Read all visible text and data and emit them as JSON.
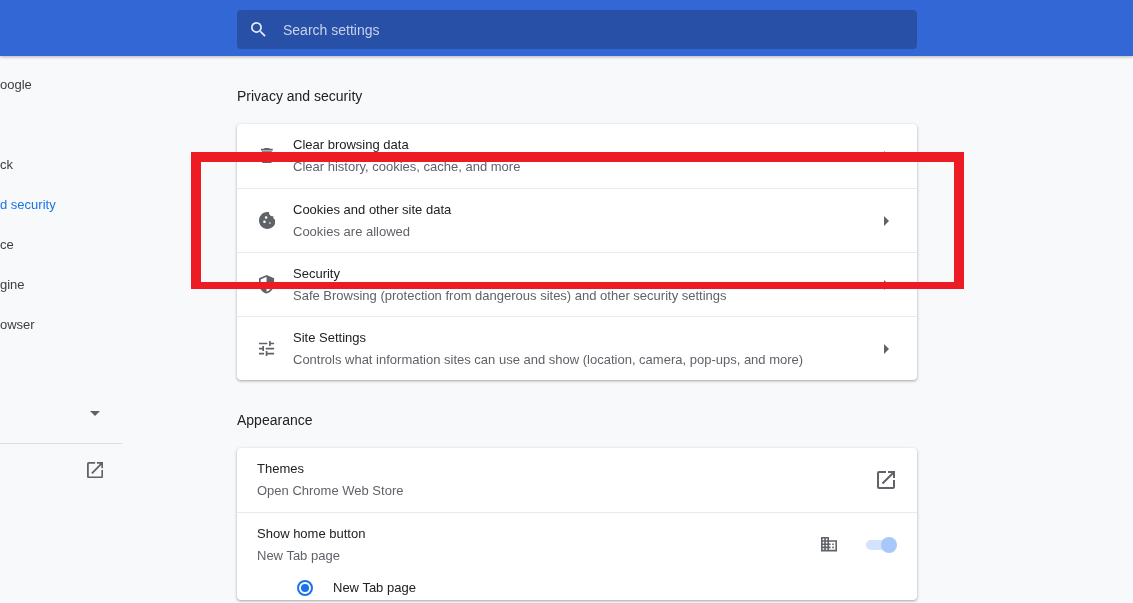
{
  "header": {
    "search": {
      "placeholder": "Search settings"
    }
  },
  "sidebar": {
    "items": [
      {
        "label": "oogle",
        "selected": false
      },
      {
        "label": "ck",
        "selected": false
      },
      {
        "label": "d security",
        "selected": true
      },
      {
        "label": "ce",
        "selected": false
      },
      {
        "label": "gine",
        "selected": false
      },
      {
        "label": "owser",
        "selected": false
      }
    ],
    "advanced": {
      "expanded": false
    }
  },
  "sections": [
    {
      "title": "Privacy and security",
      "rows": [
        {
          "kind": "link",
          "title": "Clear browsing data",
          "subtitle": "Clear history, cookies, cache, and more"
        },
        {
          "kind": "link",
          "title": "Cookies and other site data",
          "subtitle": "Cookies are allowed"
        },
        {
          "kind": "link",
          "title": "Security",
          "subtitle": "Safe Browsing (protection from dangerous sites) and other security settings"
        },
        {
          "kind": "link",
          "title": "Site Settings",
          "subtitle": "Controls what information sites can use and show (location, camera, pop-ups, and more)"
        }
      ]
    },
    {
      "title": "Appearance",
      "rows": [
        {
          "kind": "external",
          "title": "Themes",
          "subtitle": "Open Chrome Web Store"
        },
        {
          "kind": "toggle",
          "title": "Show home button",
          "subtitle": "New Tab page",
          "on": true,
          "disabled": true,
          "managed": true,
          "options": [
            {
              "label": "New Tab page",
              "selected": true
            }
          ]
        }
      ]
    }
  ],
  "annotation": {
    "kind": "rectangle"
  }
}
